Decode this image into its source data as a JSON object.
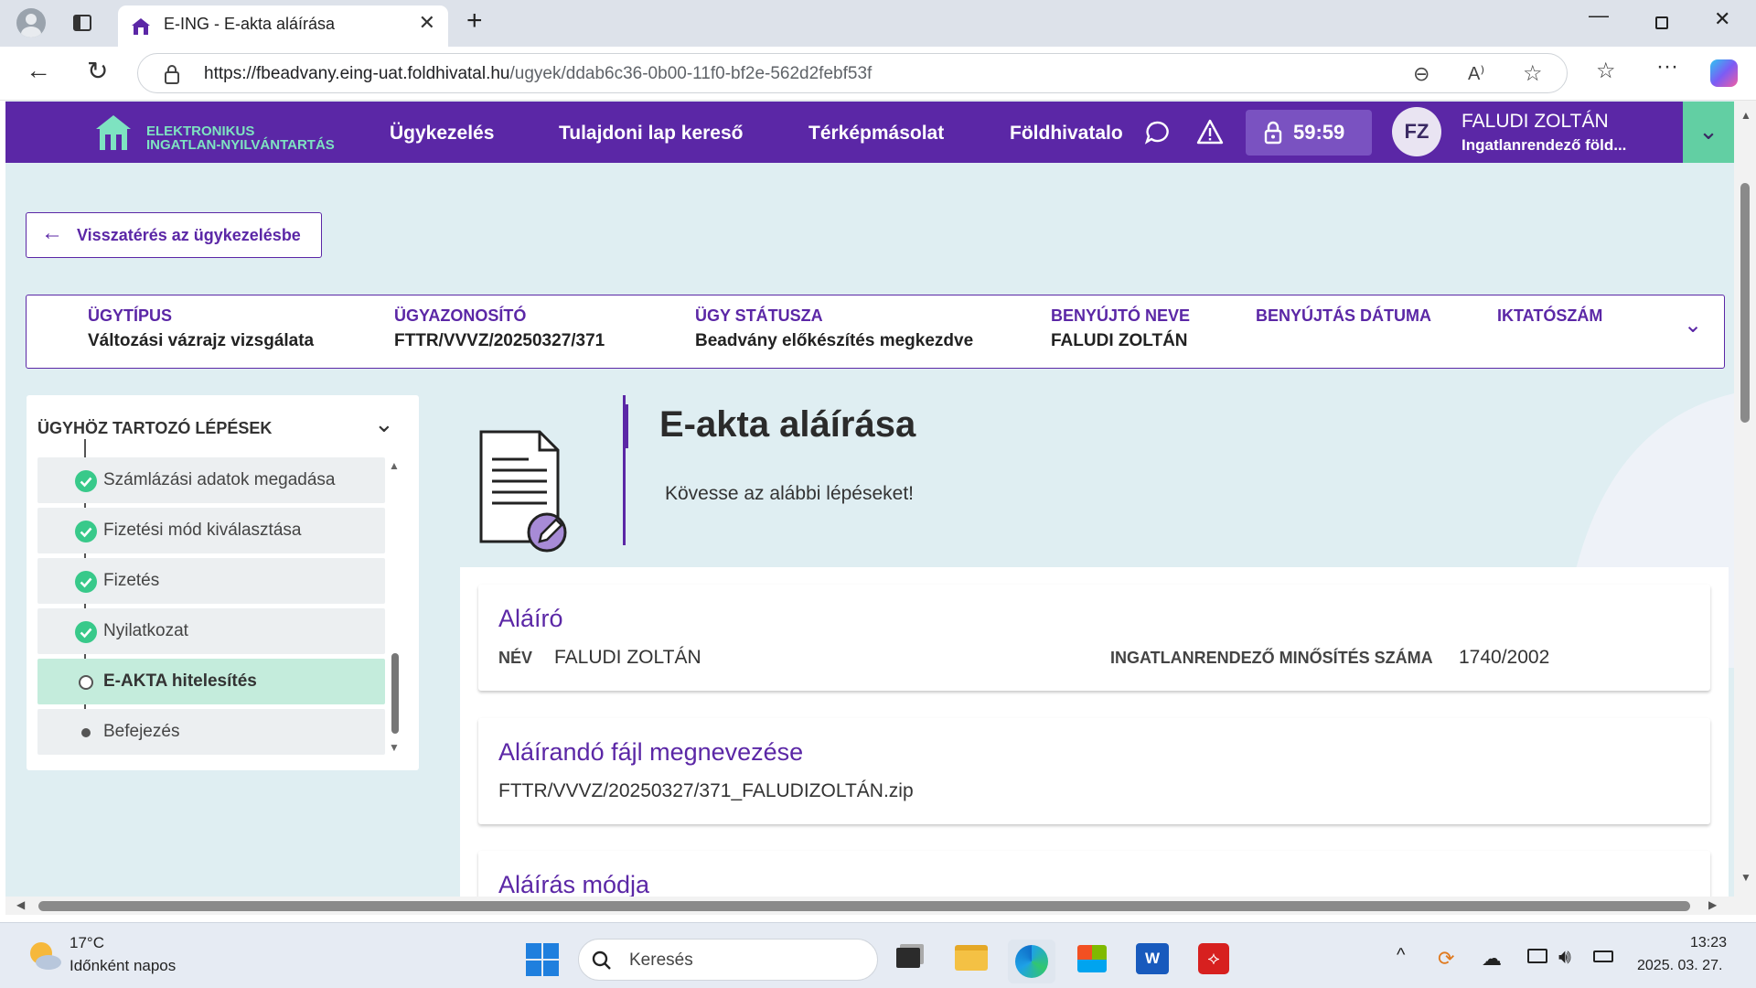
{
  "browser": {
    "tab_title": "E-ING - E-akta aláírása",
    "url_host": "https://fbeadvany.eing-uat.foldhivatal.hu",
    "url_path": "/ugyek/ddab6c36-0b00-11f0-bf2e-562d2febf53f"
  },
  "topnav": {
    "logo_line1": "ELEKTRONIKUS",
    "logo_line2": "INGATLAN-NYILVÁNTARTÁS",
    "items": [
      "Ügykezelés",
      "Tulajdoni lap kereső",
      "Térképmásolat",
      "Földhivatalo"
    ],
    "timer": "59:59",
    "avatar_initials": "FZ",
    "user_name": "FALUDI ZOLTÁN",
    "user_role": "Ingatlanrendező föld..."
  },
  "back_button": "Visszatérés az ügykezelésbe",
  "case": {
    "columns": [
      {
        "label": "ÜGYTÍPUS",
        "value": "Változási vázrajz vizsgálata"
      },
      {
        "label": "ÜGYAZONOSÍTÓ",
        "value": "FTTR/VVVZ/20250327/371"
      },
      {
        "label": "ÜGY STÁTUSZA",
        "value": "Beadvány előkészítés megkezdve"
      },
      {
        "label": "BENYÚJTÓ NEVE",
        "value": "FALUDI ZOLTÁN"
      },
      {
        "label": "BENYÚJTÁS DÁTUMA",
        "value": ""
      },
      {
        "label": "IKTATÓSZÁM",
        "value": ""
      }
    ]
  },
  "steps": {
    "header": "ÜGYHÖZ TARTOZÓ LÉPÉSEK",
    "items": [
      {
        "label": "Számlázási adatok megadása",
        "state": "done"
      },
      {
        "label": "Fizetési mód kiválasztása",
        "state": "done"
      },
      {
        "label": "Fizetés",
        "state": "done"
      },
      {
        "label": "Nyilatkozat",
        "state": "done"
      },
      {
        "label": "E-AKTA hitelesítés",
        "state": "active"
      },
      {
        "label": "Befejezés",
        "state": "pending"
      }
    ]
  },
  "main": {
    "title": "E-akta aláírása",
    "subtitle": "Kövesse az alábbi lépéseket!",
    "signer": {
      "heading": "Aláíró",
      "name_label": "NÉV",
      "name_value": "FALUDI ZOLTÁN",
      "cert_label": "INGATLANRENDEZŐ MINŐSÍTÉS SZÁMA",
      "cert_value": "1740/2002"
    },
    "file": {
      "heading": "Aláírandó fájl megnevezése",
      "filename": "FTTR/VVVZ/20250327/371_FALUDIZOLTÁN.zip"
    },
    "method": {
      "heading": "Aláírás módja"
    }
  },
  "taskbar": {
    "weather_temp": "17°C",
    "weather_desc": "Időnként napos",
    "search_placeholder": "Keresés",
    "time": "13:23",
    "date": "2025. 03. 27."
  },
  "colors": {
    "brand_purple": "#5b27a6",
    "accent_green": "#62cfa3",
    "page_bg": "#dfeef2"
  }
}
